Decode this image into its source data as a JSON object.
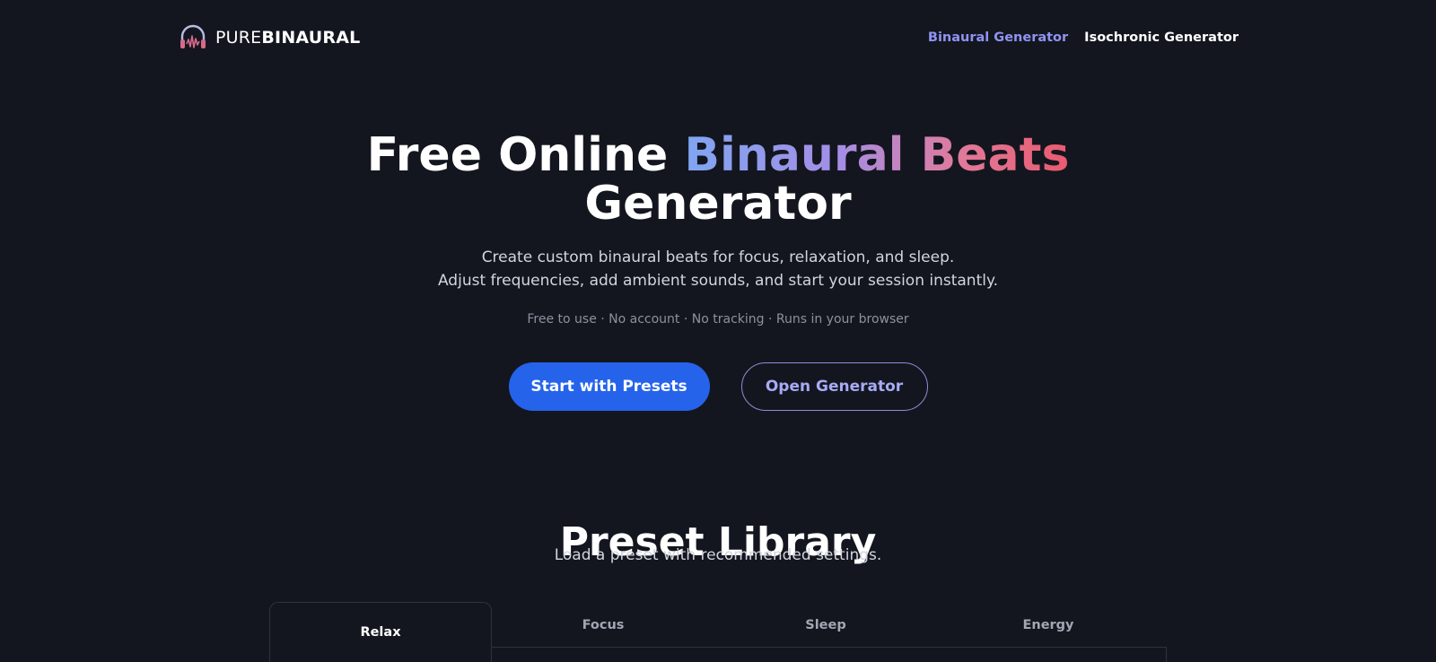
{
  "header": {
    "logo": {
      "light": "PURE",
      "bold": "BINAURAL",
      "icon": "headphones-waveform-icon"
    },
    "nav": [
      {
        "label": "Binaural Generator",
        "active": true
      },
      {
        "label": "Isochronic Generator",
        "active": false
      }
    ]
  },
  "hero": {
    "title_part1": "Free Online ",
    "title_highlight": "Binaural Beats",
    "title_part2": "Generator",
    "subtitle_line1": "Create custom binaural beats for focus, relaxation, and sleep.",
    "subtitle_line2": "Adjust frequencies, add ambient sounds, and start your session instantly.",
    "note": "Free to use · No account · No tracking · Runs in your browser",
    "primary_button": "Start with Presets",
    "secondary_button": "Open Generator"
  },
  "presets": {
    "title": "Preset Library",
    "subtitle": "Load a preset with recommended settings.",
    "tabs": [
      {
        "label": "Relax",
        "active": true
      },
      {
        "label": "Focus",
        "active": false
      },
      {
        "label": "Sleep",
        "active": false
      },
      {
        "label": "Energy",
        "active": false
      }
    ]
  },
  "colors": {
    "background": "#14161f",
    "accent_blue": "#2563eb",
    "nav_active": "#8f93f2",
    "gradient": [
      "#7fa6f2",
      "#a48ee6",
      "#e07a9a",
      "#ea5a6f"
    ]
  }
}
